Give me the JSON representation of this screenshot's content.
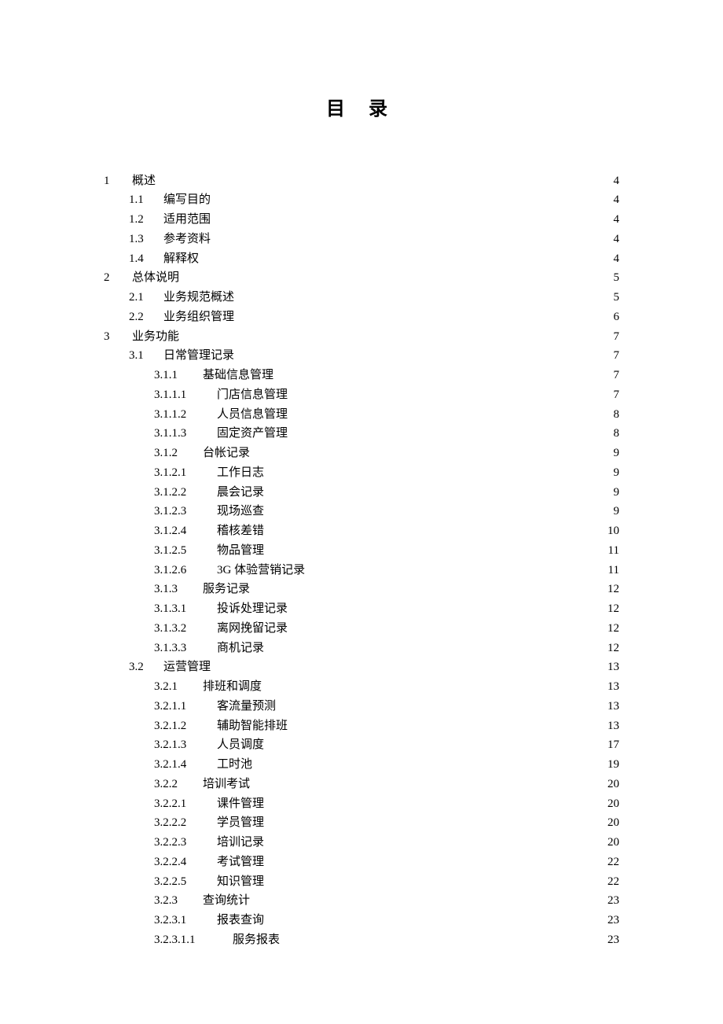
{
  "title": "目 录",
  "toc": [
    {
      "level": 0,
      "num": "1",
      "label": "概述",
      "page": "4"
    },
    {
      "level": 1,
      "num": "1.1",
      "label": "编写目的",
      "page": "4"
    },
    {
      "level": 1,
      "num": "1.2",
      "label": "适用范围",
      "page": "4"
    },
    {
      "level": 1,
      "num": "1.3",
      "label": "参考资料",
      "page": "4"
    },
    {
      "level": 1,
      "num": "1.4",
      "label": "解释权",
      "page": "4"
    },
    {
      "level": 0,
      "num": "2",
      "label": "总体说明",
      "page": "5"
    },
    {
      "level": 1,
      "num": "2.1",
      "label": "业务规范概述",
      "page": "5"
    },
    {
      "level": 1,
      "num": "2.2",
      "label": "业务组织管理",
      "page": "6"
    },
    {
      "level": 0,
      "num": "3",
      "label": "业务功能",
      "page": "7"
    },
    {
      "level": 1,
      "num": "3.1",
      "label": "日常管理记录",
      "page": "7"
    },
    {
      "level": 2,
      "num": "3.1.1",
      "label": "基础信息管理",
      "page": "7"
    },
    {
      "level": 3,
      "num": "3.1.1.1",
      "label": "门店信息管理",
      "page": "7"
    },
    {
      "level": 3,
      "num": "3.1.1.2",
      "label": "人员信息管理",
      "page": "8"
    },
    {
      "level": 3,
      "num": "3.1.1.3",
      "label": "固定资产管理",
      "page": "8"
    },
    {
      "level": 2,
      "num": "3.1.2",
      "label": "台帐记录",
      "page": "9"
    },
    {
      "level": 3,
      "num": "3.1.2.1",
      "label": "工作日志",
      "page": "9"
    },
    {
      "level": 3,
      "num": "3.1.2.2",
      "label": "晨会记录",
      "page": "9"
    },
    {
      "level": 3,
      "num": "3.1.2.3",
      "label": "现场巡查",
      "page": "9"
    },
    {
      "level": 3,
      "num": "3.1.2.4",
      "label": "稽核差错",
      "page": "10"
    },
    {
      "level": 3,
      "num": "3.1.2.5",
      "label": "物品管理",
      "page": "11"
    },
    {
      "level": 3,
      "num": "3.1.2.6",
      "label": "3G 体验营销记录",
      "page": "11"
    },
    {
      "level": 2,
      "num": "3.1.3",
      "label": "服务记录",
      "page": "12"
    },
    {
      "level": 3,
      "num": "3.1.3.1",
      "label": "投诉处理记录",
      "page": "12"
    },
    {
      "level": 3,
      "num": "3.1.3.2",
      "label": "离网挽留记录",
      "page": "12"
    },
    {
      "level": 3,
      "num": "3.1.3.3",
      "label": "商机记录",
      "page": "12"
    },
    {
      "level": 1,
      "num": "3.2",
      "label": "运营管理",
      "page": "13"
    },
    {
      "level": 2,
      "num": "3.2.1",
      "label": "排班和调度",
      "page": "13"
    },
    {
      "level": 3,
      "num": "3.2.1.1",
      "label": "客流量预测",
      "page": "13"
    },
    {
      "level": 3,
      "num": "3.2.1.2",
      "label": "辅助智能排班",
      "page": "13"
    },
    {
      "level": 3,
      "num": "3.2.1.3",
      "label": "人员调度",
      "page": "17"
    },
    {
      "level": 3,
      "num": "3.2.1.4",
      "label": "工时池",
      "page": "19"
    },
    {
      "level": 2,
      "num": "3.2.2",
      "label": "培训考试",
      "page": "20"
    },
    {
      "level": 3,
      "num": "3.2.2.1",
      "label": "课件管理",
      "page": "20"
    },
    {
      "level": 3,
      "num": "3.2.2.2",
      "label": "学员管理",
      "page": "20"
    },
    {
      "level": 3,
      "num": "3.2.2.3",
      "label": "培训记录",
      "page": "20"
    },
    {
      "level": 3,
      "num": "3.2.2.4",
      "label": "考试管理",
      "page": "22"
    },
    {
      "level": 3,
      "num": "3.2.2.5",
      "label": "知识管理",
      "page": "22"
    },
    {
      "level": 2,
      "num": "3.2.3",
      "label": "查询统计",
      "page": "23"
    },
    {
      "level": 3,
      "num": "3.2.3.1",
      "label": "报表查询",
      "page": "23"
    },
    {
      "level": 4,
      "num": "3.2.3.1.1",
      "label": "服务报表",
      "page": "23"
    }
  ]
}
